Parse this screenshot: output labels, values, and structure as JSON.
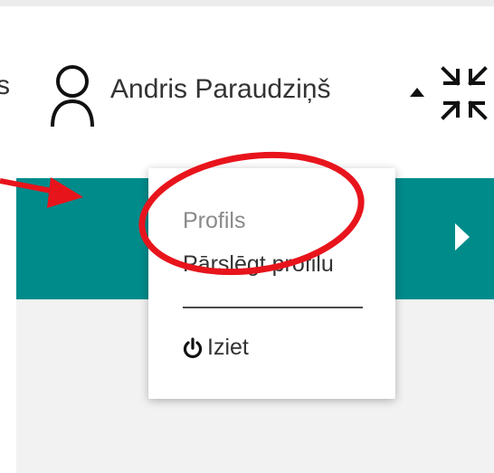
{
  "header": {
    "left_text": "s",
    "user_name": "Andris Paraudziņš",
    "user_icon": "user-icon",
    "menu_toggle_icon": "caret-up-icon",
    "collapse_icon": "compress-icon"
  },
  "banner": {
    "color": "#008b8b",
    "next_icon": "chevron-right-icon"
  },
  "dropdown": {
    "items": [
      {
        "label": "Profils"
      },
      {
        "label": "Pārslēgt profilu"
      }
    ],
    "logout": {
      "label": "Iziet",
      "icon": "power-icon"
    }
  },
  "annotation": {
    "highlight_color": "#e8141c"
  }
}
